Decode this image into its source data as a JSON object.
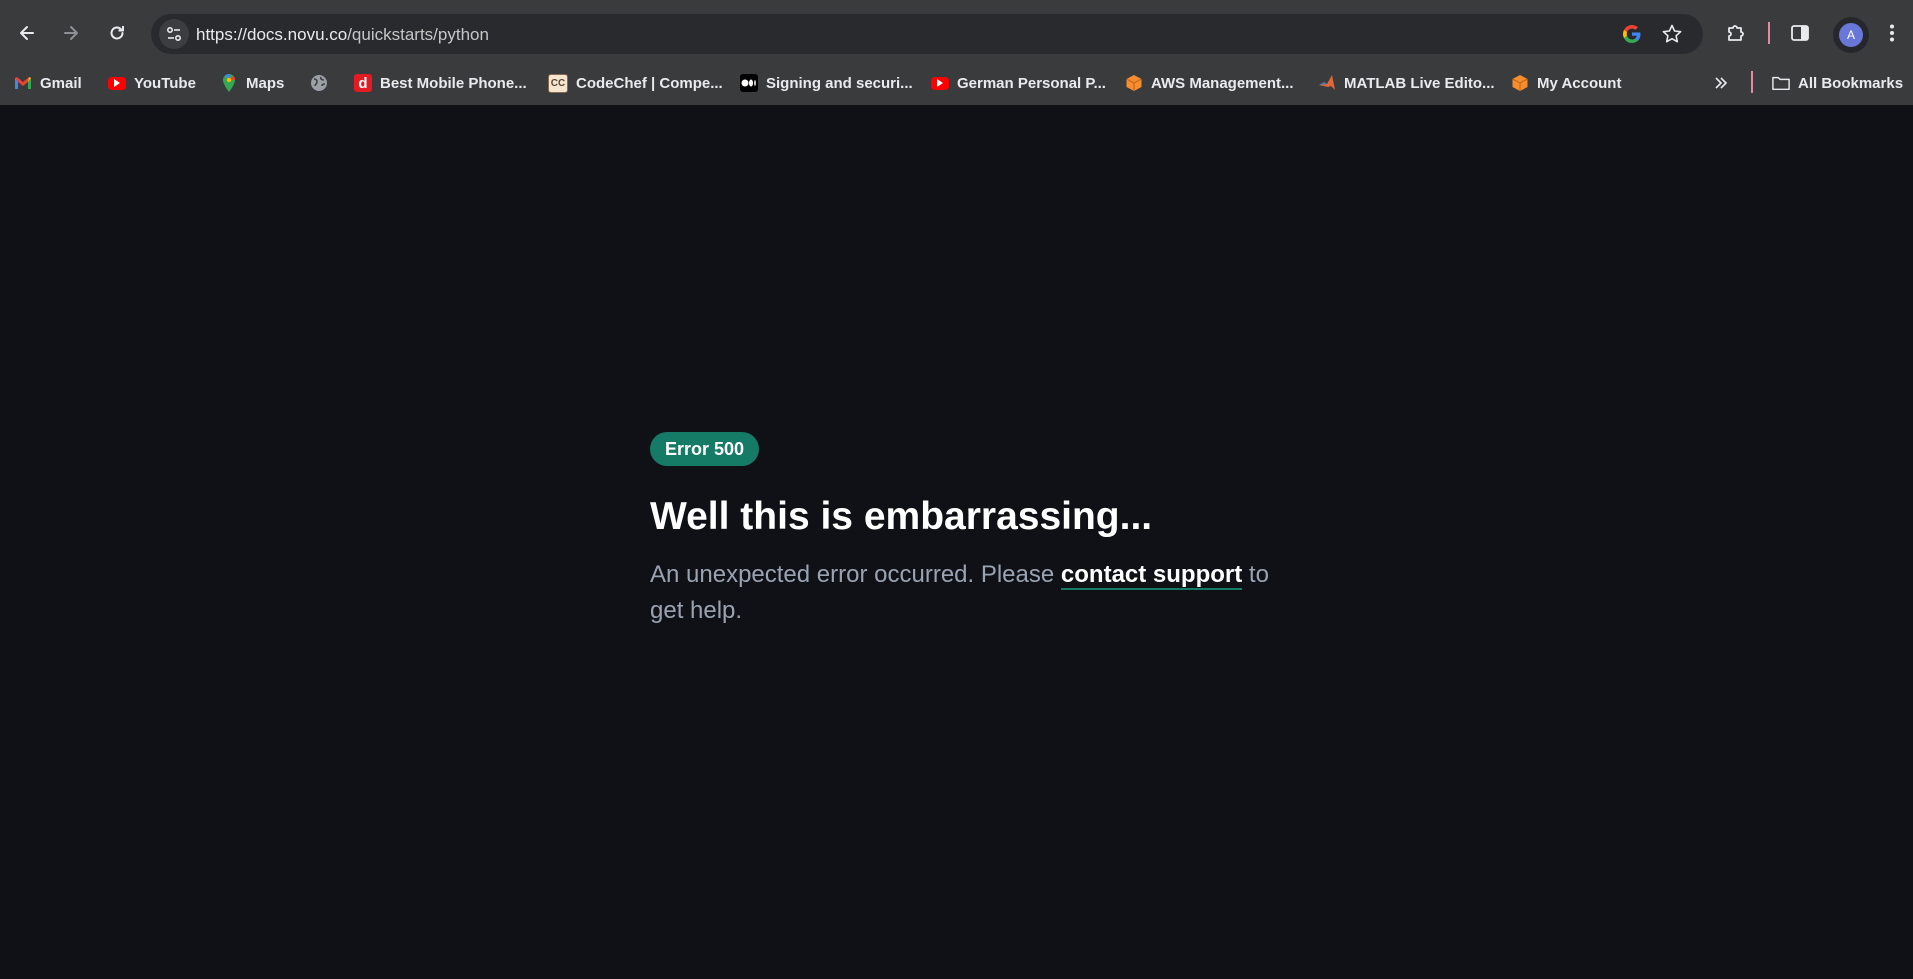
{
  "browser": {
    "url_host": "https://docs.novu.co",
    "url_path": "/quickstarts/python",
    "avatar_letter": "A",
    "bookmarks": [
      {
        "label": "Gmail",
        "icon": "gmail-icon"
      },
      {
        "label": "YouTube",
        "icon": "youtube-icon"
      },
      {
        "label": "Maps",
        "icon": "maps-icon"
      },
      {
        "label": "",
        "icon": "globe-icon"
      },
      {
        "label": "Best Mobile Phone...",
        "icon": "d-icon"
      },
      {
        "label": "CodeChef | Compe...",
        "icon": "codechef-icon"
      },
      {
        "label": "Signing and securi...",
        "icon": "medium-icon"
      },
      {
        "label": "German Personal P...",
        "icon": "youtube-icon"
      },
      {
        "label": "AWS Management...",
        "icon": "aws-icon"
      },
      {
        "label": "MATLAB Live Edito...",
        "icon": "matlab-icon"
      },
      {
        "label": "My Account",
        "icon": "aws-icon"
      }
    ],
    "all_bookmarks": "All Bookmarks"
  },
  "page": {
    "badge": "Error 500",
    "title": "Well this is embarrassing...",
    "message_before": "An unexpected error occurred. Please ",
    "link_text": "contact support",
    "message_after": " to get help."
  },
  "colors": {
    "background": "#0f1117",
    "accent": "#157a66",
    "muted_text": "#9aa3b2"
  }
}
